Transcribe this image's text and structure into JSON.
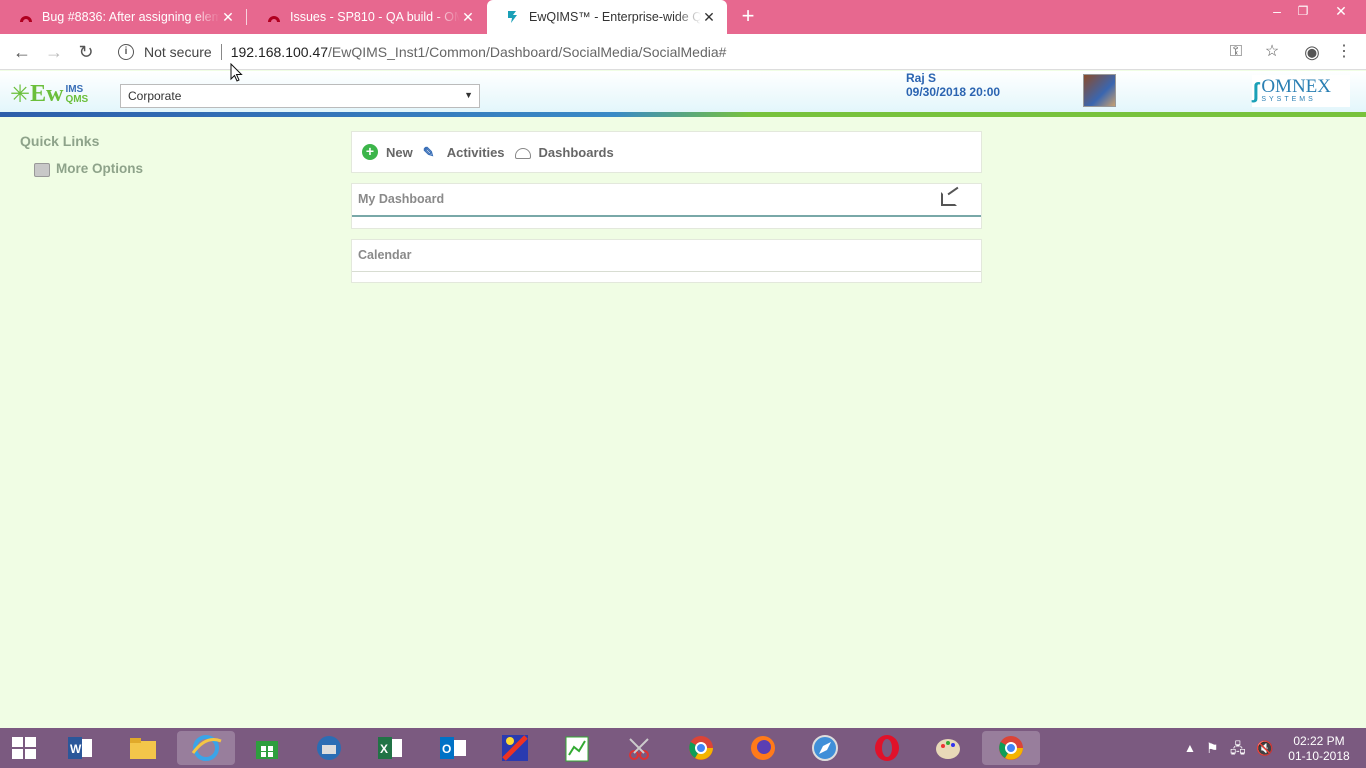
{
  "browser": {
    "tabs": [
      {
        "title": "Bug #8836: After assigning elem",
        "active": false
      },
      {
        "title": "Issues - SP810 - QA build - OMN",
        "active": false
      },
      {
        "title": "EwQIMS™ - Enterprise-wide Qua",
        "active": true
      }
    ],
    "security_label": "Not secure",
    "url_host": "192.168.100.47",
    "url_path": "/EwQIMS_Inst1/Common/Dashboard/SocialMedia/SocialMedia#"
  },
  "header": {
    "logo_text": "Ew",
    "logo_sub_top": "IMS",
    "logo_sub_bottom": "QMS",
    "company_selected": "Corporate",
    "user_name": "Raj S",
    "user_datetime": "09/30/2018 20:00",
    "brand_name": "OMNEX",
    "brand_sub": "SYSTEMS"
  },
  "sidebar": {
    "title": "Quick Links",
    "more_options": "More Options"
  },
  "toolbar": {
    "new_label": "New",
    "activities_label": "Activities",
    "dashboards_label": "Dashboards"
  },
  "panels": {
    "my_dashboard": "My Dashboard",
    "calendar": "Calendar"
  },
  "taskbar": {
    "time": "02:22 PM",
    "date": "01-10-2018"
  },
  "colors": {
    "tabstrip": "#e7688f",
    "page_bg": "#f0fde4",
    "taskbar": "#7b5a80",
    "user_text": "#2b64b1"
  }
}
